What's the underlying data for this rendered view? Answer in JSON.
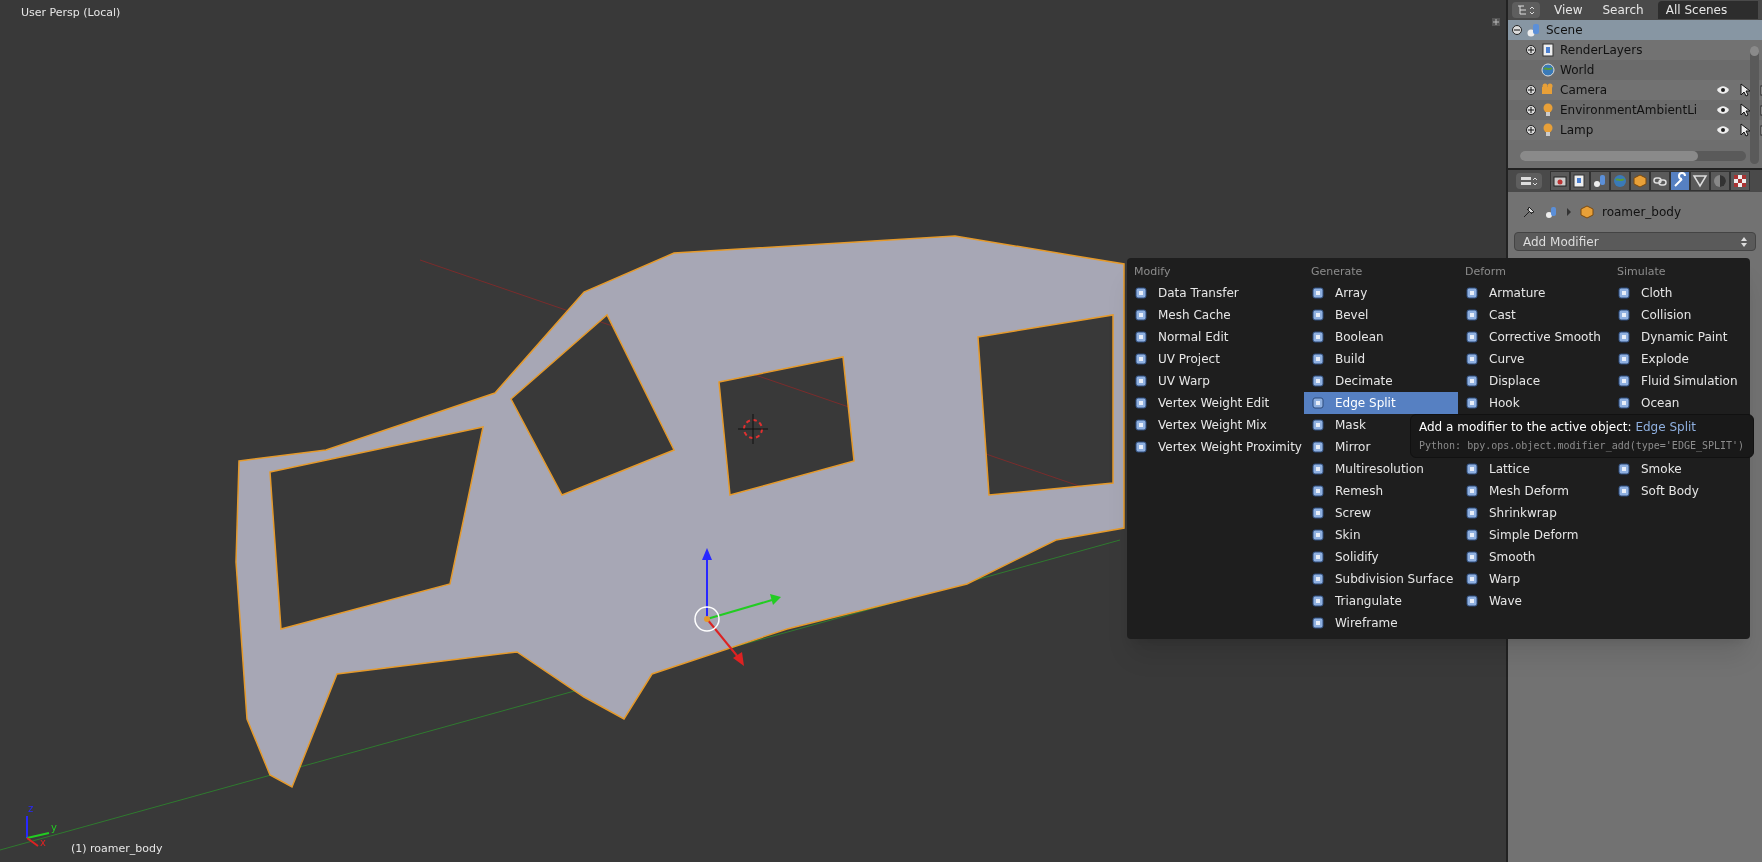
{
  "viewport": {
    "title": "User Persp (Local)",
    "object_label": "(1) roamer_body",
    "axes": [
      {
        "label": "z",
        "color": "#2828ff"
      },
      {
        "label": "y",
        "color": "#22cc22"
      },
      {
        "label": "x",
        "color": "#dd2222"
      }
    ]
  },
  "outliner": {
    "menus": [
      "View",
      "Search"
    ],
    "scene_selector": "All Scenes",
    "items": [
      {
        "label": "Scene",
        "expanded": true,
        "selected": true,
        "children": [
          {
            "label": "RenderLayers",
            "expanded": false,
            "selected": false
          },
          {
            "label": "World",
            "selected": false
          },
          {
            "label": "Camera",
            "expanded": false,
            "selected": false,
            "visible": true,
            "selectable": true,
            "renderable": true
          },
          {
            "label": "EnvironmentAmbientLi",
            "expanded": false,
            "selected": false,
            "visible": true,
            "selectable": true,
            "renderable": true
          },
          {
            "label": "Lamp",
            "expanded": false,
            "selected": false,
            "visible": true,
            "selectable": true,
            "renderable": true
          }
        ]
      }
    ]
  },
  "properties": {
    "tabs": [
      {
        "kind": "render",
        "selected": false
      },
      {
        "kind": "layers",
        "selected": false
      },
      {
        "kind": "scene",
        "selected": false
      },
      {
        "kind": "world",
        "selected": false
      },
      {
        "kind": "object",
        "selected": false
      },
      {
        "kind": "constraints",
        "selected": false
      },
      {
        "kind": "modifiers",
        "selected": true
      },
      {
        "kind": "data",
        "selected": false
      },
      {
        "kind": "material",
        "selected": false
      },
      {
        "kind": "texture",
        "selected": false
      }
    ],
    "breadcrumb": "roamer_body",
    "add_modifier": "Add Modifier"
  },
  "menu": {
    "columns": [
      {
        "title": "Modify",
        "items": [
          {
            "label": "Data Transfer",
            "selected": false
          },
          {
            "label": "Mesh Cache",
            "selected": false
          },
          {
            "label": "Normal Edit",
            "selected": false
          },
          {
            "label": "UV Project",
            "selected": false
          },
          {
            "label": "UV Warp",
            "selected": false
          },
          {
            "label": "Vertex Weight Edit",
            "selected": false
          },
          {
            "label": "Vertex Weight Mix",
            "selected": false
          },
          {
            "label": "Vertex Weight Proximity",
            "selected": false
          }
        ]
      },
      {
        "title": "Generate",
        "items": [
          {
            "label": "Array",
            "selected": false
          },
          {
            "label": "Bevel",
            "selected": false
          },
          {
            "label": "Boolean",
            "selected": false
          },
          {
            "label": "Build",
            "selected": false
          },
          {
            "label": "Decimate",
            "selected": false
          },
          {
            "label": "Edge Split",
            "selected": true
          },
          {
            "label": "Mask",
            "selected": false
          },
          {
            "label": "Mirror",
            "selected": false
          },
          {
            "label": "Multiresolution",
            "selected": false
          },
          {
            "label": "Remesh",
            "selected": false
          },
          {
            "label": "Screw",
            "selected": false
          },
          {
            "label": "Skin",
            "selected": false
          },
          {
            "label": "Solidify",
            "selected": false
          },
          {
            "label": "Subdivision Surface",
            "selected": false
          },
          {
            "label": "Triangulate",
            "selected": false
          },
          {
            "label": "Wireframe",
            "selected": false
          }
        ]
      },
      {
        "title": "Deform",
        "items": [
          {
            "label": "Armature",
            "selected": false
          },
          {
            "label": "Cast",
            "selected": false
          },
          {
            "label": "Corrective Smooth",
            "selected": false
          },
          {
            "label": "Curve",
            "selected": false
          },
          {
            "label": "Displace",
            "selected": false
          },
          {
            "label": "Hook",
            "selected": false
          },
          {
            "label": "Lattice",
            "selected": false,
            "gap_before": true
          },
          {
            "label": "Mesh Deform",
            "selected": false
          },
          {
            "label": "Shrinkwrap",
            "selected": false
          },
          {
            "label": "Simple Deform",
            "selected": false
          },
          {
            "label": "Smooth",
            "selected": false
          },
          {
            "label": "Warp",
            "selected": false
          },
          {
            "label": "Wave",
            "selected": false
          }
        ]
      },
      {
        "title": "Simulate",
        "items": [
          {
            "label": "Cloth",
            "selected": false
          },
          {
            "label": "Collision",
            "selected": false
          },
          {
            "label": "Dynamic Paint",
            "selected": false
          },
          {
            "label": "Explode",
            "selected": false
          },
          {
            "label": "Fluid Simulation",
            "selected": false
          },
          {
            "label": "Ocean",
            "selected": false
          },
          {
            "label": "Smoke",
            "selected": false,
            "gap_before": true
          },
          {
            "label": "Soft Body",
            "selected": false
          }
        ]
      }
    ]
  },
  "tooltip": {
    "description": "Add a modifier to the active object:",
    "value": "Edge Split",
    "python": "Python: bpy.ops.object.modifier_add(type='EDGE_SPLIT')"
  }
}
